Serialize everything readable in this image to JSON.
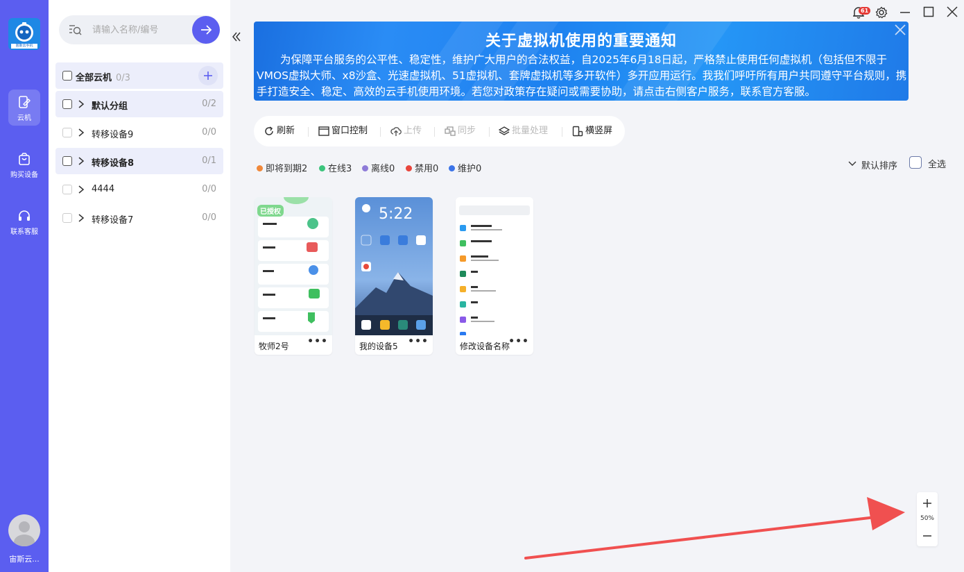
{
  "rail": {
    "logo_text": "宙斯云手机",
    "items": [
      {
        "label": "云机",
        "icon": "cloud-phone-icon",
        "active": true
      },
      {
        "label": "购买设备",
        "icon": "shopping-bag-icon",
        "active": false
      },
      {
        "label": "联系客服",
        "icon": "headset-icon",
        "active": false
      }
    ],
    "user_name": "宙斯云..."
  },
  "sidebar": {
    "search": {
      "placeholder": "请输入名称/编号"
    },
    "all": {
      "label": "全部云机",
      "count": "0/3"
    },
    "groups": [
      {
        "label": "默认分组",
        "count": "0/2",
        "bold": true,
        "highlighted": true
      },
      {
        "label": "转移设备9",
        "count": "0/0",
        "bold": false,
        "highlighted": false
      },
      {
        "label": "转移设备8",
        "count": "0/1",
        "bold": true,
        "highlighted": true
      },
      {
        "label": "4444",
        "count": "0/0",
        "bold": false,
        "highlighted": false
      },
      {
        "label": "转移设备7",
        "count": "0/0",
        "bold": false,
        "highlighted": false
      }
    ]
  },
  "header": {
    "notification_count": "61"
  },
  "notice": {
    "title": "关于虚拟机使用的重要通知",
    "body": "为保障平台服务的公平性、稳定性，维护广大用户的合法权益，自2025年6月18日起，严格禁止使用任何虚拟机（包括但不限于VMOS虚拟大师、x8沙盒、光速虚拟机、51虚拟机、套牌虚拟机等多开软件）多开应用运行。我我们呼吁所有用户共同遵守平台规则，携手打造安全、稳定、高效的云手机使用环境。若您对政策存在疑问或需要协助，请点击右侧客户服务，联系官方客服。"
  },
  "toolbar": {
    "refresh": "刷新",
    "window_control": "窗口控制",
    "upload": "上传",
    "sync": "同步",
    "batch": "批量处理",
    "orientation": "横竖屏"
  },
  "status": {
    "expiring": "即将到期2",
    "online": "在线3",
    "offline": "离线0",
    "disabled": "禁用0",
    "maintenance": "维护0",
    "colors": {
      "expiring": "#f0883a",
      "online": "#3cc47c",
      "offline": "#8e7bd8",
      "disabled": "#e8453c",
      "maintenance": "#3c74e8"
    }
  },
  "sort": {
    "label": "默认排序"
  },
  "select_all": {
    "label": "全选"
  },
  "devices": [
    {
      "name": "牧师2号",
      "badge": "已授权",
      "screen": "app"
    },
    {
      "name": "我的设备5",
      "screen": "home",
      "clock": "5:22"
    },
    {
      "name": "修改设备名称",
      "screen": "settings"
    }
  ],
  "zoom": {
    "level": "50%"
  }
}
